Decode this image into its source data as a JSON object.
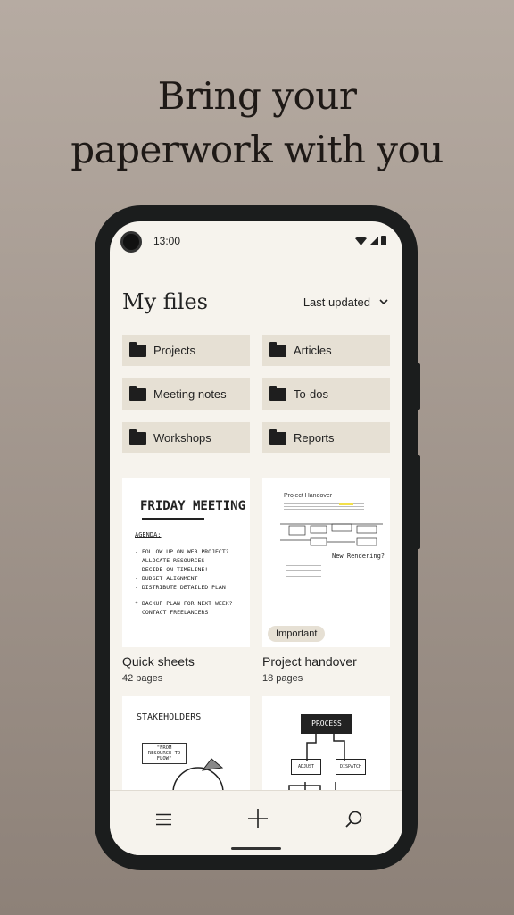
{
  "headline": {
    "line1": "Bring your",
    "line2": "paperwork with you"
  },
  "status_bar": {
    "time": "13:00"
  },
  "header": {
    "title": "My files",
    "sort_label": "Last updated"
  },
  "folders": [
    {
      "label": "Projects"
    },
    {
      "label": "Articles"
    },
    {
      "label": "Meeting notes"
    },
    {
      "label": "To-dos"
    },
    {
      "label": "Workshops"
    },
    {
      "label": "Reports"
    }
  ],
  "cards": [
    {
      "title": "Quick sheets",
      "pages": "42 pages",
      "thumb": {
        "heading": "FRIDAY MEETING",
        "sub": "AGENDA:",
        "lines": [
          "- FOLLOW UP ON WEB PROJECT?",
          "- ALLOCATE RESOURCES",
          "- DECIDE ON TIMELINE!",
          "- BUDGET ALIGNMENT",
          "- DISTRIBUTE DETAILED PLAN",
          "* BACKUP PLAN FOR NEXT WEEK?",
          "CONTACT FREELANCERS"
        ]
      }
    },
    {
      "title": "Project handover",
      "pages": "18 pages",
      "badge": "Important",
      "thumb": {
        "heading": "Project Handover",
        "note": "New Rendering?"
      }
    },
    {
      "thumb": {
        "heading": "STAKEHOLDERS",
        "quote": "\"FROM RESOURCE TO FLOW\""
      }
    },
    {
      "thumb": {
        "heading": "PROCESS",
        "left": "ADJUST",
        "right": "DISPATCH"
      }
    }
  ],
  "nav": {
    "items": [
      "menu-icon",
      "add-icon",
      "search-icon"
    ]
  }
}
